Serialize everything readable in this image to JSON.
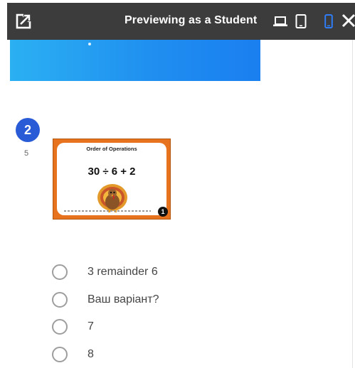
{
  "header": {
    "title": "Previewing as a Student",
    "exit_icon": "open-in-new-icon",
    "devices": [
      {
        "name": "laptop",
        "icon": "laptop-icon",
        "active": false
      },
      {
        "name": "tablet",
        "icon": "tablet-icon",
        "active": false
      },
      {
        "name": "phone",
        "icon": "phone-icon",
        "active": true
      }
    ],
    "close_icon": "close-icon",
    "colors": {
      "bar": "#3c3c3c",
      "icon": "#ffffff",
      "active": "#2f7df6"
    }
  },
  "banner": {
    "colors": [
      "#2bb0f2",
      "#1a7ff0"
    ]
  },
  "question": {
    "number": "2",
    "points": "5",
    "image": {
      "heading": "Order of Operations",
      "expression": "30 ÷ 6 + 2",
      "card_number": "1",
      "border_color": "#e8731f"
    },
    "options": [
      {
        "label": "3 remainder 6"
      },
      {
        "label": "Ваш варіант?"
      },
      {
        "label": "7"
      },
      {
        "label": "8"
      }
    ],
    "accent": "#2a5bd7"
  }
}
